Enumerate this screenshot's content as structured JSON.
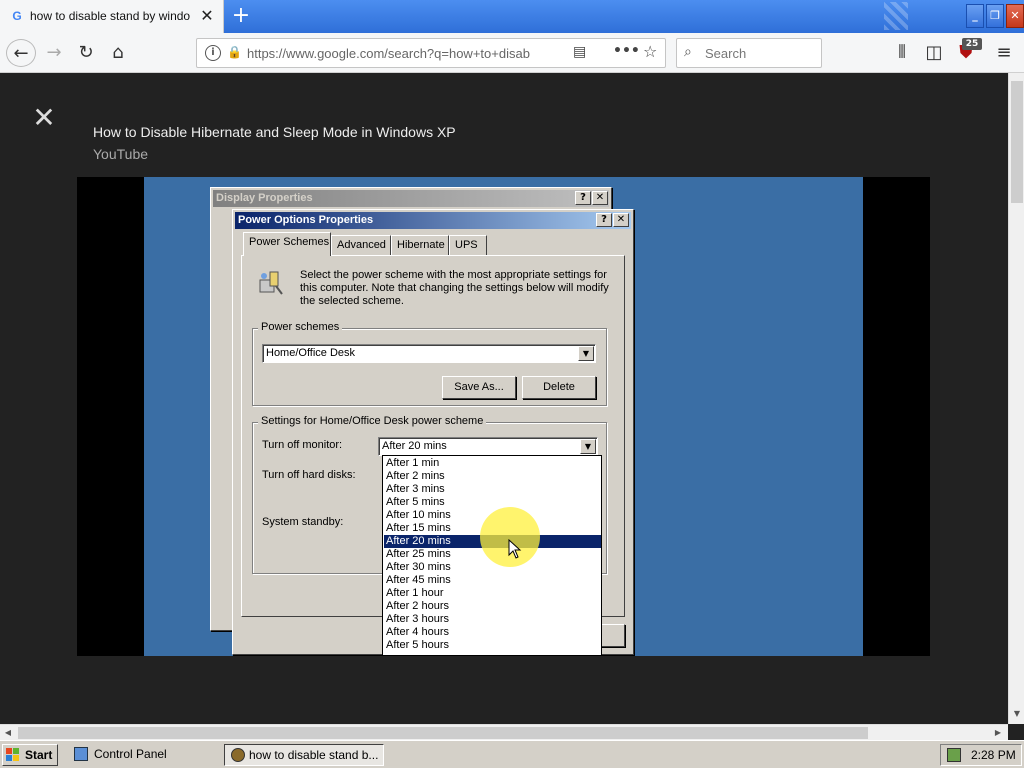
{
  "browser": {
    "tab_title": "how to disable stand by windows",
    "tab_favicon": "G",
    "url": "https://www.google.com/search?q=how+to+disab",
    "search_placeholder": "Search",
    "badge_count": "25"
  },
  "overlay": {
    "video_title": "How to Disable Hibernate and Sleep Mode in Windows XP",
    "video_source": "YouTube"
  },
  "xp": {
    "display_title": "Display Properties",
    "power_title": "Power Options Properties",
    "help_btn": "?",
    "close_btn": "✕",
    "tabs": [
      "Power Schemes",
      "Advanced",
      "Hibernate",
      "UPS"
    ],
    "description": [
      "Select the power scheme with the most appropriate settings for",
      "this computer. Note that changing the settings below will modify",
      "the selected scheme."
    ],
    "power_schemes_label": "Power schemes",
    "scheme_value": "Home/Office Desk",
    "save_as": "Save As...",
    "delete": "Delete",
    "settings_label": "Settings for Home/Office Desk power scheme",
    "turn_off_monitor_label": "Turn off monitor:",
    "turn_off_monitor_value": "After 20 mins",
    "turn_off_disks_label": "Turn off hard disks:",
    "standby_label": "System standby:",
    "dropdown_options": [
      "After 1 min",
      "After 2 mins",
      "After 3 mins",
      "After 5 mins",
      "After 10 mins",
      "After 15 mins",
      "After 20 mins",
      "After 25 mins",
      "After 30 mins",
      "After 45 mins",
      "After 1 hour",
      "After 2 hours",
      "After 3 hours",
      "After 4 hours",
      "After 5 hours"
    ],
    "highlighted_option": "After 20 mins"
  },
  "taskbar": {
    "start": "Start",
    "items": [
      "Control Panel",
      "how to disable stand b..."
    ],
    "clock": "2:28 PM"
  }
}
